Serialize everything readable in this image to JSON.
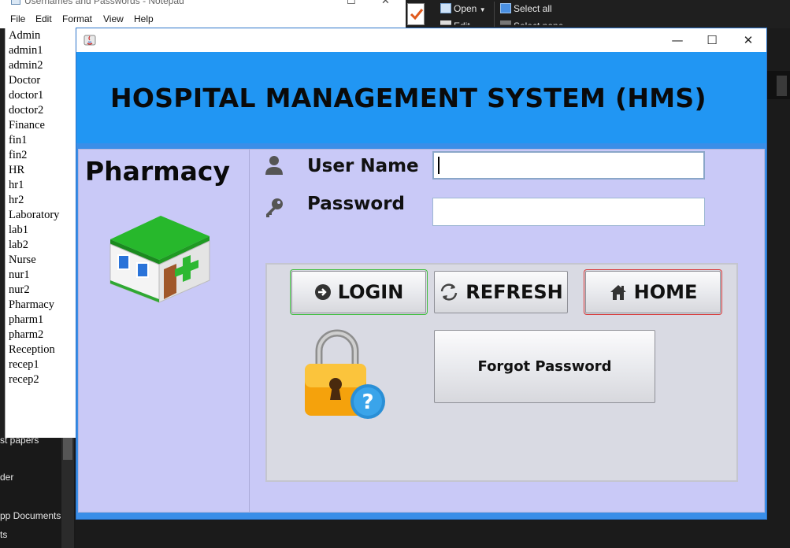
{
  "notepad": {
    "title": "Usernames and Passwords - Notepad",
    "menu": [
      "File",
      "Edit",
      "Format",
      "View",
      "Help"
    ],
    "lines": [
      "Admin",
      "admin1",
      "admin2",
      "Doctor",
      "doctor1",
      "doctor2",
      "Finance",
      "fin1",
      "fin2",
      "HR",
      "hr1",
      "hr2",
      "Laboratory",
      "lab1",
      "lab2",
      "Nurse",
      "nur1",
      "nur2",
      "Pharmacy",
      "pharm1",
      "pharm2",
      "Reception",
      "recep1",
      "recep2"
    ]
  },
  "explorer": {
    "ribbon": {
      "open": "Open",
      "edit": "Edit",
      "select_all": "Select all",
      "select_none": "Select none"
    },
    "left_items": [
      "st papers",
      "der",
      "pp Documents",
      "ts"
    ]
  },
  "app": {
    "window_controls": {
      "minimize": "—",
      "maximize": "☐",
      "close": "✕"
    },
    "header_title": "HOSPITAL MANAGEMENT SYSTEM (HMS)",
    "module_title": "Pharmacy",
    "username_label": "User Name",
    "password_label": "Password",
    "username_value": "",
    "password_value": "",
    "buttons": {
      "login": "LOGIN",
      "refresh": "REFRESH",
      "home": "HOME",
      "forgot": "Forgot Password"
    },
    "colors": {
      "header": "#2196f3",
      "panel": "#c9c9f7",
      "button_panel": "#d9dae3",
      "login_outline": "#3fbe3f",
      "home_outline": "#d83a3a"
    }
  }
}
